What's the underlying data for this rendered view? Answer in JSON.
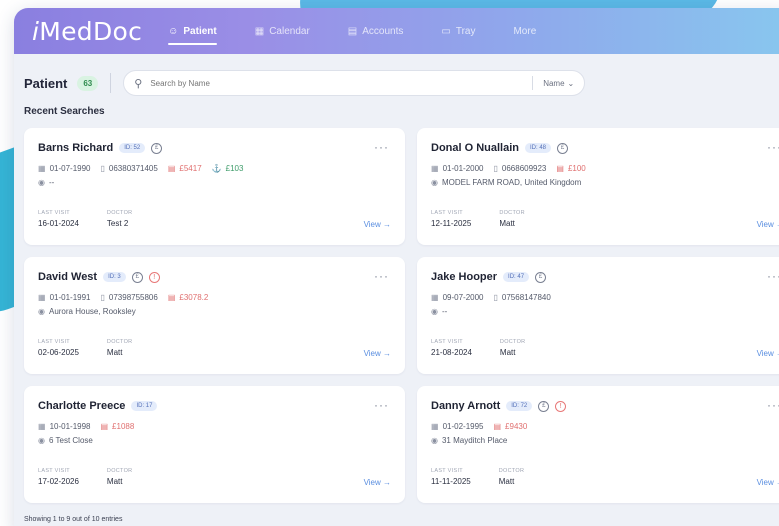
{
  "brand": {
    "name": "MedDoc"
  },
  "nav": [
    {
      "label": "Patient",
      "icon": "person-icon",
      "active": true
    },
    {
      "label": "Calendar",
      "icon": "calendar-icon",
      "active": false
    },
    {
      "label": "Accounts",
      "icon": "accounts-icon",
      "active": false
    },
    {
      "label": "Tray",
      "icon": "tray-icon",
      "active": false
    },
    {
      "label": "More",
      "icon": "",
      "active": false
    }
  ],
  "toolbar": {
    "title": "Patient",
    "count": "63",
    "search_placeholder": "Search by Name",
    "sort_label": "Name"
  },
  "section": {
    "recent": "Recent Searches"
  },
  "labels": {
    "last_visit": "LAST VISIT",
    "doctor": "DOCTOR",
    "view": "View →"
  },
  "patients": [
    {
      "name": "Barns Richard",
      "id": "ID: 52",
      "dob": "01-07-1990",
      "phone": "06380371405",
      "balance": "£5417",
      "credit": "£103",
      "address": "--",
      "last_visit": "16-01-2024",
      "doctor": "Test 2"
    },
    {
      "name": "Donal O Nuallain",
      "id": "ID: 48",
      "dob": "01-01-2000",
      "phone": "0668609923",
      "balance": "£100",
      "address": "MODEL FARM ROAD, United Kingdom",
      "last_visit": "12-11-2025",
      "doctor": "Matt"
    },
    {
      "name": "David West",
      "id": "ID: 3",
      "dob": "01-01-1991",
      "phone": "07398755806",
      "balance": "£3078.2",
      "address": "Aurora House, Rooksley",
      "last_visit": "02-06-2025",
      "doctor": "Matt"
    },
    {
      "name": "Jake Hooper",
      "id": "ID: 47",
      "dob": "09-07-2000",
      "phone": "07568147840",
      "address": "--",
      "last_visit": "21-08-2024",
      "doctor": "Matt"
    },
    {
      "name": "Charlotte Preece",
      "id": "ID: 17",
      "dob": "10-01-1998",
      "balance": "£1088",
      "address": "6 Test Close",
      "last_visit": "17-02-2026",
      "doctor": "Matt"
    },
    {
      "name": "Danny Arnott",
      "id": "ID: 72",
      "dob": "01-02-1995",
      "balance": "£9430",
      "address": "31 Mayditch Place",
      "last_visit": "11-11-2025",
      "doctor": "Matt"
    }
  ],
  "footer": {
    "entries": "Showing 1 to 9 out of 10 entries"
  },
  "colors": {
    "accent": "#8a7fe0",
    "link": "#5a8ee0",
    "alert": "#e07070"
  }
}
